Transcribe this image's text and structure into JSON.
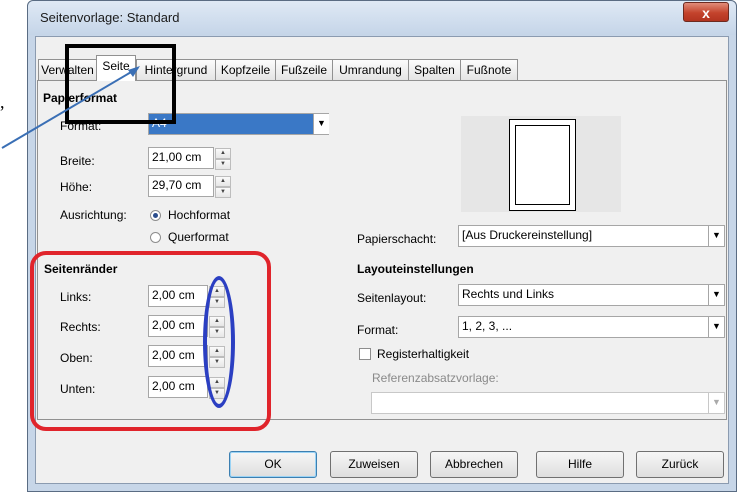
{
  "window": {
    "title": "Seitenvorlage: Standard",
    "close_glyph": "x"
  },
  "tabs": [
    "Verwalten",
    "Seite",
    "Hintergrund",
    "Kopfzeile",
    "Fußzeile",
    "Umrandung",
    "Spalten",
    "Fußnote"
  ],
  "papierformat": {
    "heading": "Papierformat",
    "format_label": "Format:",
    "format_value": "A4",
    "breite_label": "Breite:",
    "breite_value": "21,00 cm",
    "hoehe_label": "Höhe:",
    "hoehe_value": "29,70 cm",
    "ausrichtung_label": "Ausrichtung:",
    "hochformat": "Hochformat",
    "querformat": "Querformat"
  },
  "seitenraender": {
    "heading": "Seitenränder",
    "links_label": "Links:",
    "links_value": "2,00 cm",
    "rechts_label": "Rechts:",
    "rechts_value": "2,00 cm",
    "oben_label": "Oben:",
    "oben_value": "2,00 cm",
    "unten_label": "Unten:",
    "unten_value": "2,00 cm"
  },
  "papierschacht": {
    "label": "Papierschacht:",
    "value": "[Aus Druckereinstellung]"
  },
  "layout": {
    "heading": "Layouteinstellungen",
    "seitenlayout_label": "Seitenlayout:",
    "seitenlayout_value": "Rechts und Links",
    "format_label": "Format:",
    "format_value": "1, 2, 3, ...",
    "registerhaltigkeit": "Registerhaltigkeit",
    "referenz_label": "Referenzabsatzvorlage:",
    "referenz_value": ""
  },
  "buttons": {
    "ok": "OK",
    "zuweisen": "Zuweisen",
    "abbrechen": "Abbrechen",
    "hilfe": "Hilfe",
    "zurueck": "Zurück"
  },
  "annotation_text": ",",
  "colors": {
    "annotation_red": "#e0242b",
    "annotation_blue": "#2b3fc2",
    "annotation_black": "#000000",
    "selection_blue": "#3a78c6"
  }
}
